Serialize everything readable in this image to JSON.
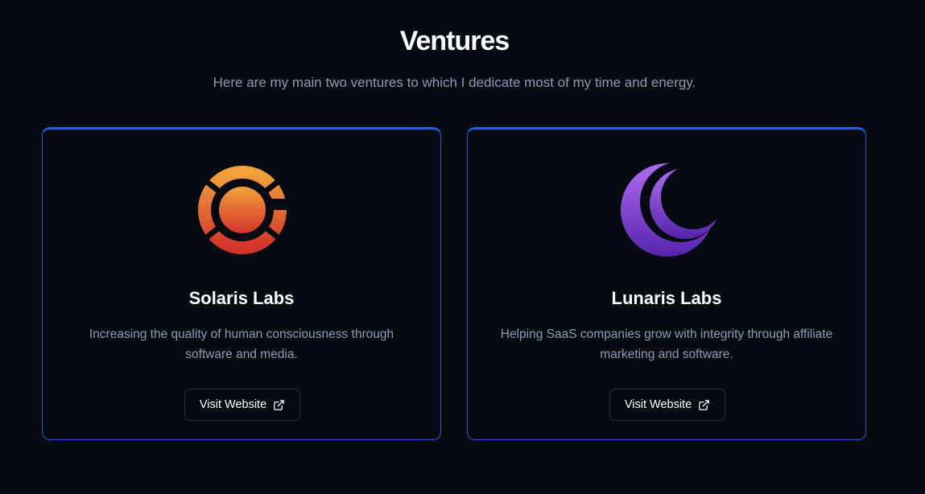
{
  "section": {
    "title": "Ventures",
    "subtitle": "Here are my main two ventures to which I dedicate most of my time and energy."
  },
  "ventures": [
    {
      "name": "Solaris Labs",
      "description": "Increasing the quality of human consciousness through software and media.",
      "button_label": "Visit Website",
      "logo_icon": "sun-rings-icon",
      "logo_colors": [
        "#f2a33a",
        "#d4332b"
      ]
    },
    {
      "name": "Lunaris Labs",
      "description": "Helping SaaS companies grow with integrity through affiliate marketing and software.",
      "button_label": "Visit Website",
      "logo_icon": "crescent-moon-icon",
      "logo_colors": [
        "#a45ce8",
        "#5b2bb3"
      ]
    }
  ],
  "colors": {
    "background": "#060a11",
    "card_border": "#1d5ed8",
    "muted_text": "#8f9bb3"
  }
}
